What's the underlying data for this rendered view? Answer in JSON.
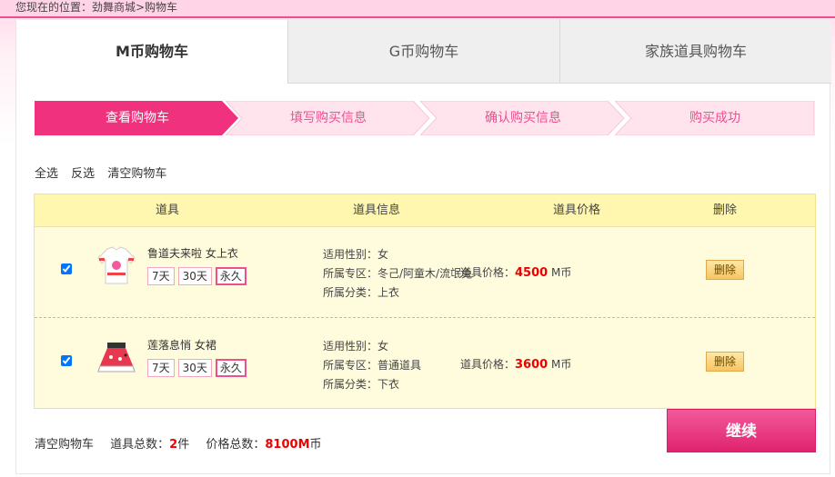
{
  "breadcrumb": {
    "text": "您现在的位置：劲舞商城>购物车"
  },
  "tabs": [
    {
      "label": "M币购物车",
      "active": true
    },
    {
      "label": "G币购物车",
      "active": false
    },
    {
      "label": "家族道具购物车",
      "active": false
    }
  ],
  "steps": [
    {
      "label": "查看购物车",
      "active": true
    },
    {
      "label": "填写购买信息",
      "active": false
    },
    {
      "label": "确认购买信息",
      "active": false
    },
    {
      "label": "购买成功",
      "active": false
    }
  ],
  "actions": {
    "select_all": "全选",
    "invert": "反选",
    "clear": "清空购物车"
  },
  "table": {
    "headers": {
      "item": "道具",
      "info": "道具信息",
      "price": "道具价格",
      "delete": "删除"
    },
    "rows": [
      {
        "checked": true,
        "name": "鲁道夫来啦 女上衣",
        "durations": [
          "7天",
          "30天",
          "永久"
        ],
        "selected_duration": "永久",
        "gender": "适用性别：女",
        "zone": "所属专区：冬己/阿童木/流氓兔",
        "category": "所属分类：上衣",
        "price_label": "道具价格：",
        "price_value": "4500",
        "price_unit": " M币",
        "delete_label": "删除"
      },
      {
        "checked": true,
        "name": "莲落息悄 女裙",
        "durations": [
          "7天",
          "30天",
          "永久"
        ],
        "selected_duration": "永久",
        "gender": "适用性别：女",
        "zone": "所属专区：普通道具",
        "category": "所属分类：下衣",
        "price_label": "道具价格：",
        "price_value": "3600",
        "price_unit": " M币",
        "delete_label": "删除"
      }
    ]
  },
  "footer": {
    "clear": "清空购物车",
    "count_label": "道具总数：",
    "count_value": "2",
    "count_unit": "件",
    "total_label": "价格总数：",
    "total_value": "8100M",
    "total_unit": "币"
  },
  "continue_label": "继续",
  "colors": {
    "accent": "#ee4f8e",
    "step_active": "#f0317e",
    "step_inactive": "#ffe4ee",
    "table_bg": "#fffbdd",
    "price": "#e00000"
  }
}
